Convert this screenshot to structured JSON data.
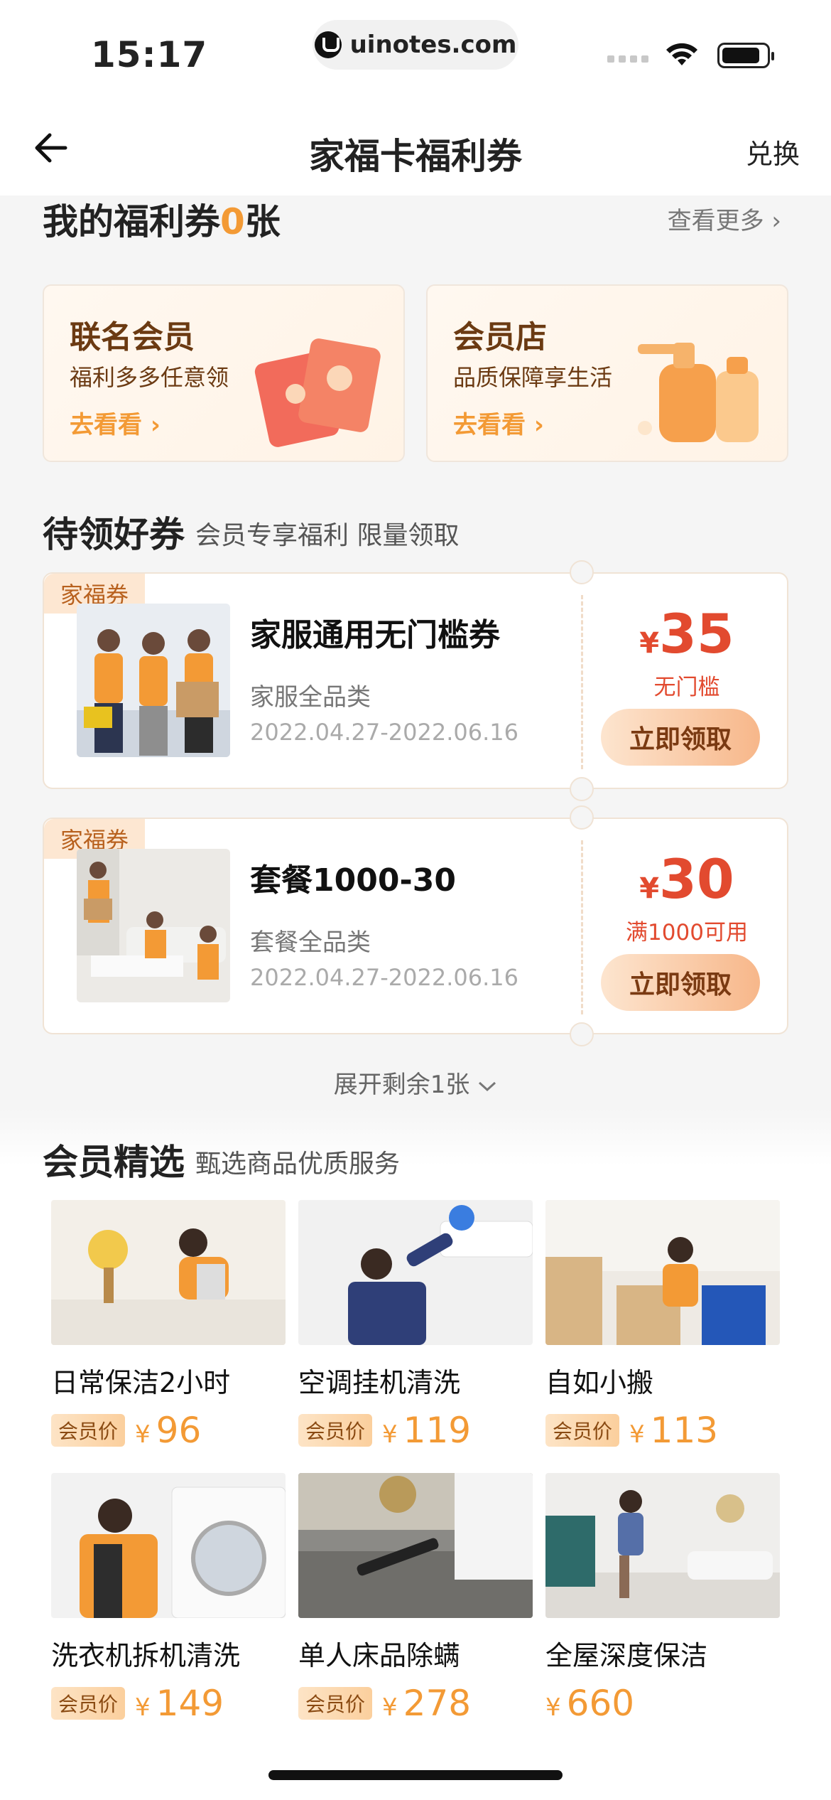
{
  "status_bar": {
    "time": "15:17",
    "url": "uinotes.com"
  },
  "nav": {
    "title": "家福卡福利券",
    "action": "兑换"
  },
  "my_coupons": {
    "title_prefix": "我的福利券",
    "count": "0",
    "title_suffix": "张",
    "see_more": "查看更多"
  },
  "promos": [
    {
      "title": "联名会员",
      "subtitle": "福利多多任意领",
      "link": "去看看"
    },
    {
      "title": "会员店",
      "subtitle": "品质保障享生活",
      "link": "去看看"
    }
  ],
  "coupon_section": {
    "title": "待领好券",
    "subtitle": "会员专享福利 限量领取"
  },
  "coupons": [
    {
      "tag": "家福券",
      "name": "家服通用无门槛券",
      "category": "家服全品类",
      "date": "2022.04.27-2022.06.16",
      "yen": "¥",
      "amount": "35",
      "condition": "无门槛",
      "button": "立即领取"
    },
    {
      "tag": "家福券",
      "name": "套餐1000-30",
      "category": "套餐全品类",
      "date": "2022.04.27-2022.06.16",
      "yen": "¥",
      "amount": "30",
      "condition": "满1000可用",
      "button": "立即领取"
    }
  ],
  "expand": "展开剩余1张",
  "products_section": {
    "title": "会员精选",
    "subtitle": "甄选商品优质服务"
  },
  "products": [
    {
      "name": "日常保洁2小时",
      "badge": "会员价",
      "yen": "¥",
      "price": "96"
    },
    {
      "name": "空调挂机清洗",
      "badge": "会员价",
      "yen": "¥",
      "price": "119"
    },
    {
      "name": "自如小搬",
      "badge": "会员价",
      "yen": "¥",
      "price": "113"
    },
    {
      "name": "洗衣机拆机清洗",
      "badge": "会员价",
      "yen": "¥",
      "price": "149"
    },
    {
      "name": "单人床品除螨",
      "badge": "会员价",
      "yen": "¥",
      "price": "278"
    },
    {
      "name": "全屋深度保洁",
      "badge": "",
      "yen": "¥",
      "price": "660"
    }
  ],
  "colors": {
    "accent": "#f39a35",
    "coupon_red": "#e24a2f",
    "background": "#f5f5f5"
  }
}
